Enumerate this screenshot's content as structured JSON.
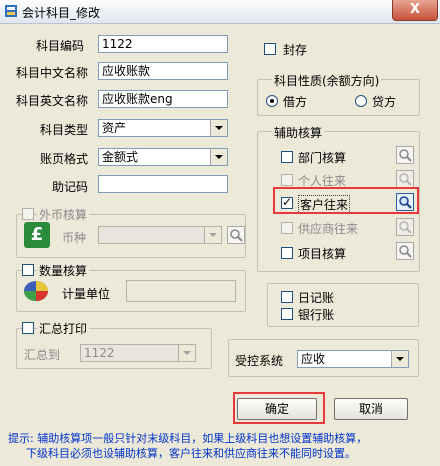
{
  "window": {
    "title": "会计科目_修改",
    "close_glyph": "X"
  },
  "form": {
    "code": {
      "label": "科目编码",
      "value": "1122"
    },
    "cn_name": {
      "label": "科目中文名称",
      "value": "应收账款"
    },
    "en_name": {
      "label": "科目英文名称",
      "value": "应收账款eng"
    },
    "type": {
      "label": "科目类型",
      "value": "资产"
    },
    "page_format": {
      "label": "账页格式",
      "value": "金额式"
    },
    "mnemonic": {
      "label": "助记码",
      "value": ""
    },
    "sealed": {
      "label": "封存",
      "checked": false
    }
  },
  "nature": {
    "title": "科目性质(余额方向)",
    "debit": "借方",
    "credit": "贷方",
    "selected": "借方"
  },
  "aux": {
    "title": "辅助核算",
    "items": [
      {
        "label": "部门核算",
        "checked": false,
        "enabled": true
      },
      {
        "label": "个人往来",
        "checked": false,
        "enabled": false
      },
      {
        "label": "客户往来",
        "checked": true,
        "enabled": true
      },
      {
        "label": "供应商往来",
        "checked": false,
        "enabled": false
      },
      {
        "label": "项目核算",
        "checked": false,
        "enabled": true
      }
    ]
  },
  "foreign": {
    "title": "外币核算",
    "currency_label": "币种",
    "currency_value": "",
    "icon_glyph": "£"
  },
  "quantity": {
    "title": "数量核算",
    "unit_label": "计量单位",
    "unit_value": ""
  },
  "summary": {
    "title": "汇总打印",
    "to_label": "汇总到",
    "to_value": "1122"
  },
  "books": {
    "journal": "日记账",
    "bank": "银行账"
  },
  "controlled": {
    "label": "受控系统",
    "value": "应收"
  },
  "buttons": {
    "ok": "确定",
    "cancel": "取消"
  },
  "tip": {
    "line1": "提示: 辅助核算项一般只针对末级科目，如果上级科目也想设置辅助核算，",
    "line2": "下级科目必须也设辅助核算，客户往来和供应商往来不能同时设置。"
  },
  "colors": {
    "highlight": "#e8383d",
    "tip_text": "#0033cc",
    "dialog_bg": "#ece9d8"
  }
}
